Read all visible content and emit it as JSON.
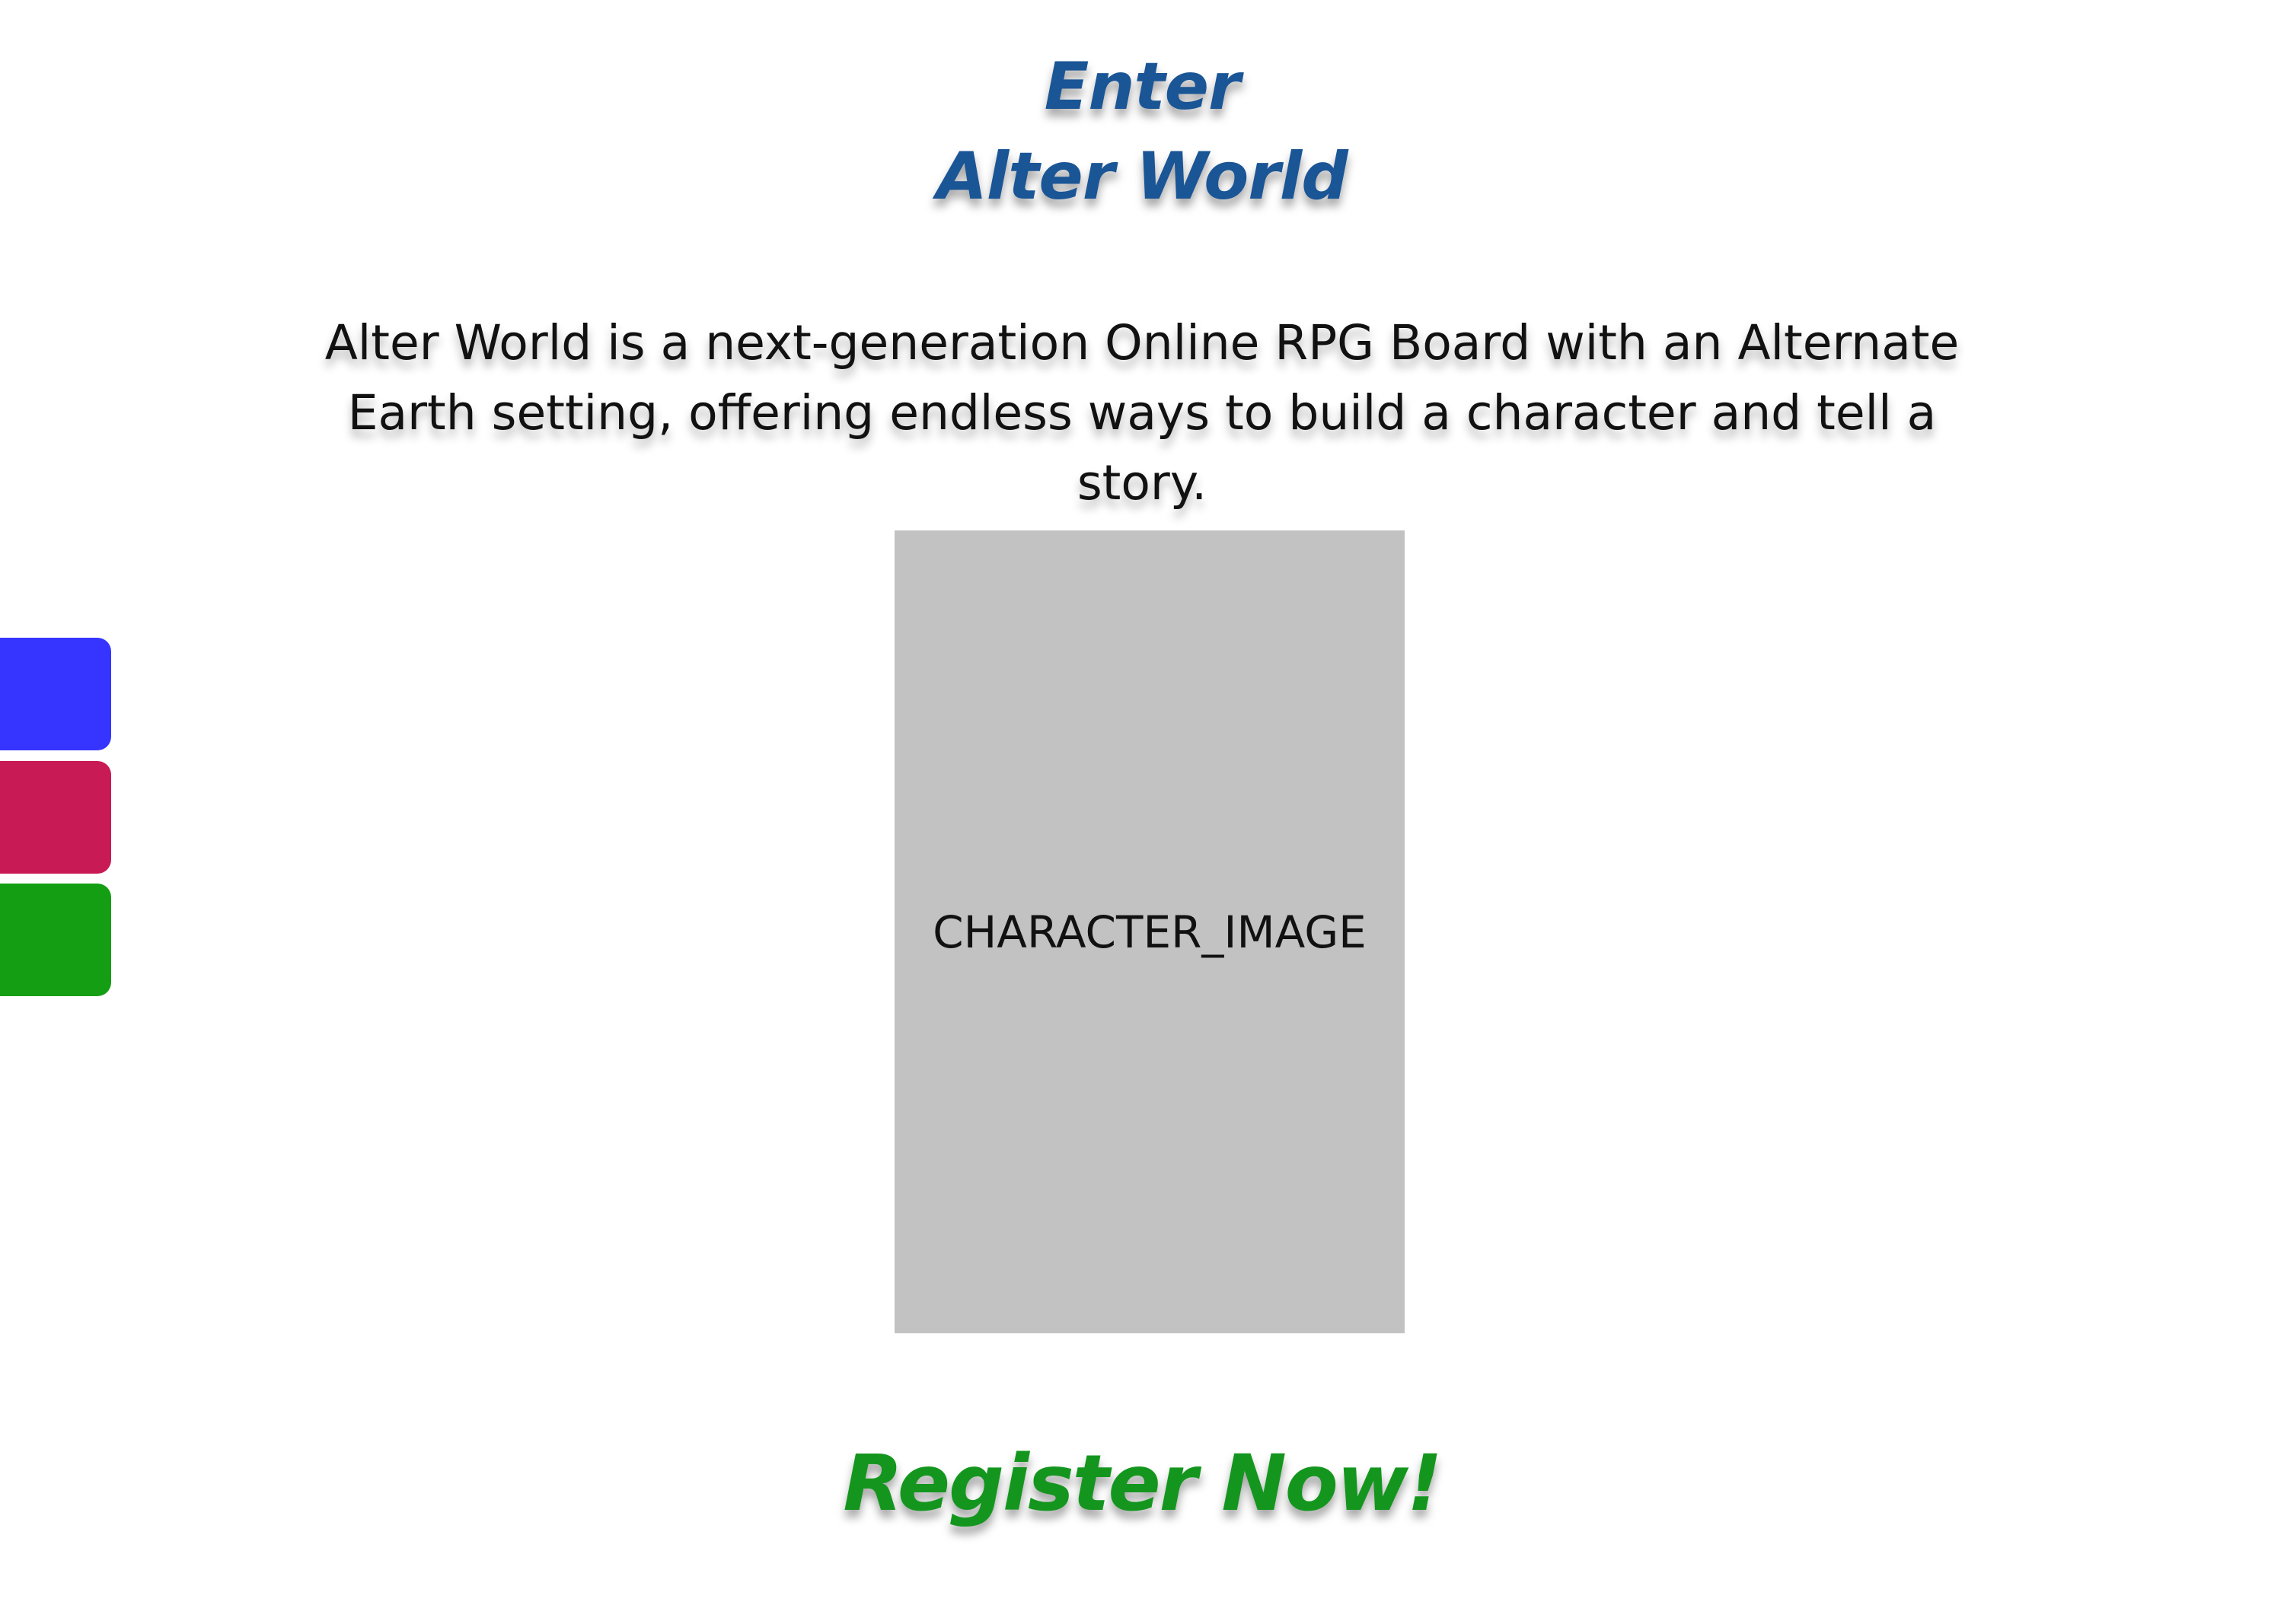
{
  "title": {
    "line1": "Enter",
    "line2": "Alter World",
    "color": "#1a5596"
  },
  "description": "Alter World is a next-generation Online RPG Board with an Alternate Earth setting, offering endless ways to build a character and tell a story.",
  "character_image": {
    "label": "CHARACTER_IMAGE",
    "background": "#c2c2c2"
  },
  "theme_swatches": [
    {
      "color": "#3535ff"
    },
    {
      "color": "#c81a55"
    },
    {
      "color": "#149e14"
    }
  ],
  "register": {
    "label": "Register Now!",
    "color": "#14961e"
  }
}
